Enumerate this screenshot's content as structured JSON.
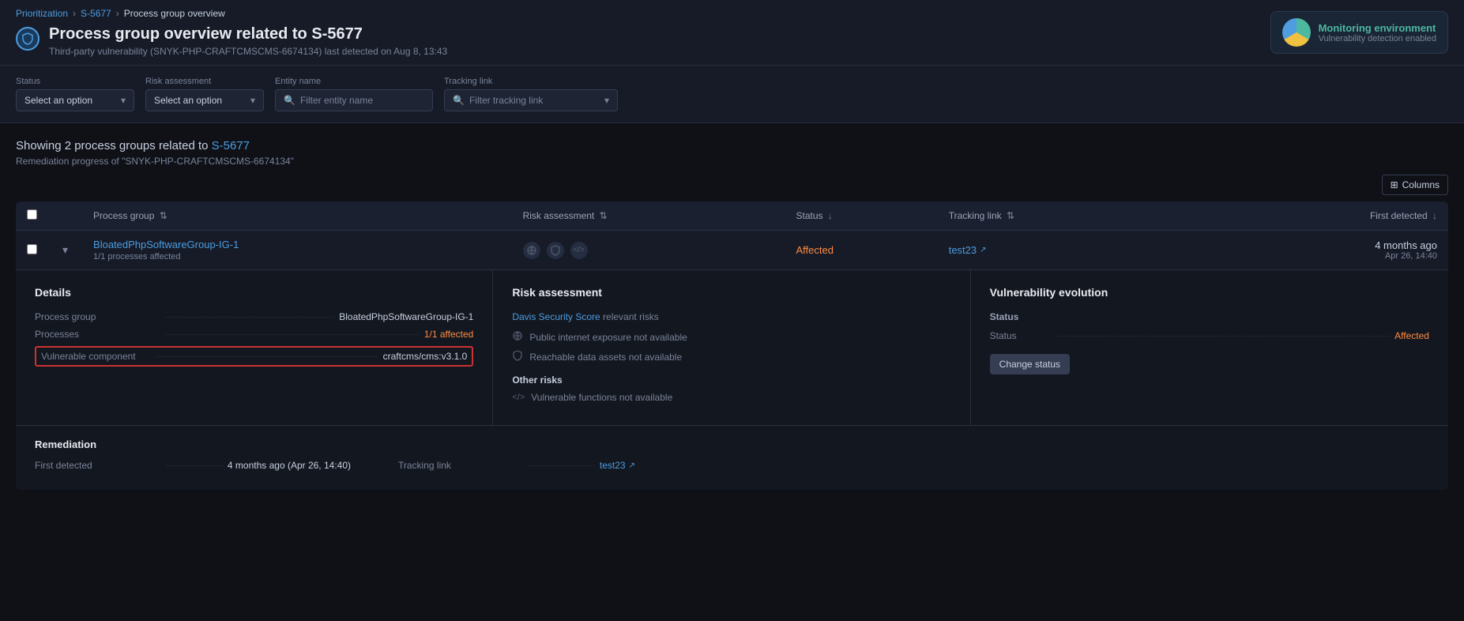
{
  "breadcrumb": {
    "items": [
      {
        "label": "Prioritization",
        "href": "#"
      },
      {
        "label": "S-5677",
        "href": "#"
      },
      {
        "label": "Process group overview",
        "href": null
      }
    ]
  },
  "page": {
    "title": "Process group overview related to S-5677",
    "subtitle": "Third-party vulnerability (SNYK-PHP-CRAFTCMSCMS-6674134) last detected on Aug 8, 13:43",
    "shield_icon": "⬡"
  },
  "monitoring": {
    "title": "Monitoring environment",
    "subtitle": "Vulnerability detection enabled"
  },
  "filters": {
    "status_label": "Status",
    "status_placeholder": "Select an option",
    "risk_label": "Risk assessment",
    "risk_placeholder": "Select an option",
    "entity_label": "Entity name",
    "entity_placeholder": "Filter entity name",
    "tracking_label": "Tracking link",
    "tracking_placeholder": "Filter tracking link"
  },
  "summary": {
    "showing_text": "Showing 2 process groups related to",
    "link_label": "S-5677",
    "remediation_text": "Remediation progress of \"SNYK-PHP-CRAFTCMSCMS-6674134\""
  },
  "toolbar": {
    "columns_label": "Columns"
  },
  "table": {
    "headers": {
      "checkbox": "",
      "expand": "",
      "process_group": "Process group",
      "risk_assessment": "Risk assessment",
      "status": "Status",
      "tracking_link": "Tracking link",
      "spacer": "",
      "first_detected": "First detected"
    },
    "rows": [
      {
        "id": "row-1",
        "process_group_name": "BloatedPhpSoftwareGroup-IG-1",
        "process_group_sub": "1/1 processes affected",
        "status": "Affected",
        "tracking_link": "test23",
        "first_detected_relative": "4 months ago",
        "first_detected_absolute": "Apr 26, 14:40"
      }
    ]
  },
  "expanded": {
    "details": {
      "title": "Details",
      "process_group_label": "Process group",
      "process_group_val": "BloatedPhpSoftwareGroup-IG-1",
      "processes_label": "Processes",
      "processes_val": "1/1 affected",
      "vuln_component_label": "Vulnerable component",
      "vuln_component_val": "craftcms/cms:v3.1.0"
    },
    "risk_assessment": {
      "title": "Risk assessment",
      "davis_score_label": "Davis Security Score",
      "davis_score_suffix": "relevant risks",
      "public_internet": "Public internet exposure not available",
      "reachable_data": "Reachable data assets not available",
      "other_risks_label": "Other risks",
      "vuln_functions": "Vulnerable functions not available"
    },
    "vulnerability_evolution": {
      "title": "Vulnerability evolution",
      "status_label": "Status",
      "status_val_label": "Status",
      "status_val": "Affected",
      "change_status_label": "Change status"
    },
    "remediation": {
      "title": "Remediation",
      "first_detected_label": "First detected",
      "first_detected_val": "4 months ago (Apr 26, 14:40)",
      "tracking_link_label": "Tracking link",
      "tracking_link_val": "test23"
    }
  }
}
